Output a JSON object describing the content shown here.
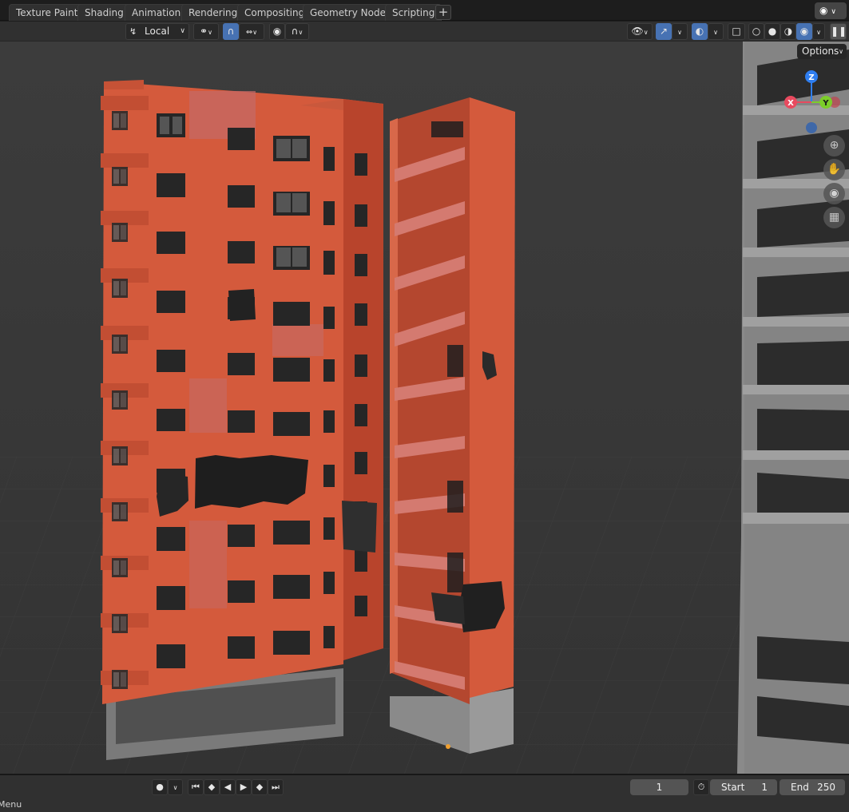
{
  "workspace_tabs": [
    "Texture Paint",
    "Shading",
    "Animation",
    "Rendering",
    "Compositing",
    "Geometry Nodes",
    "Scripting"
  ],
  "tab_add_label": "+",
  "header": {
    "transform_orientation": "Local"
  },
  "viewport": {
    "options_label": "Options",
    "gizmo": {
      "x_label": "X",
      "y_label": "Y",
      "z_label": "Z"
    },
    "colors": {
      "background": "#3a3a3a",
      "building_facade": "#d45a3c",
      "building_shadow": "#a8402a",
      "concrete": "#8a8a8a",
      "accent_blue": "#4772b3",
      "axis_x": "#e84a5f",
      "axis_y": "#7ccd2a",
      "axis_z": "#2f7ef0"
    }
  },
  "timeline": {
    "current_frame": "1",
    "start_label": "Start",
    "start_value": "1",
    "end_label": "End",
    "end_value": "250"
  },
  "statusbar": {
    "menu_label": "Menu"
  }
}
